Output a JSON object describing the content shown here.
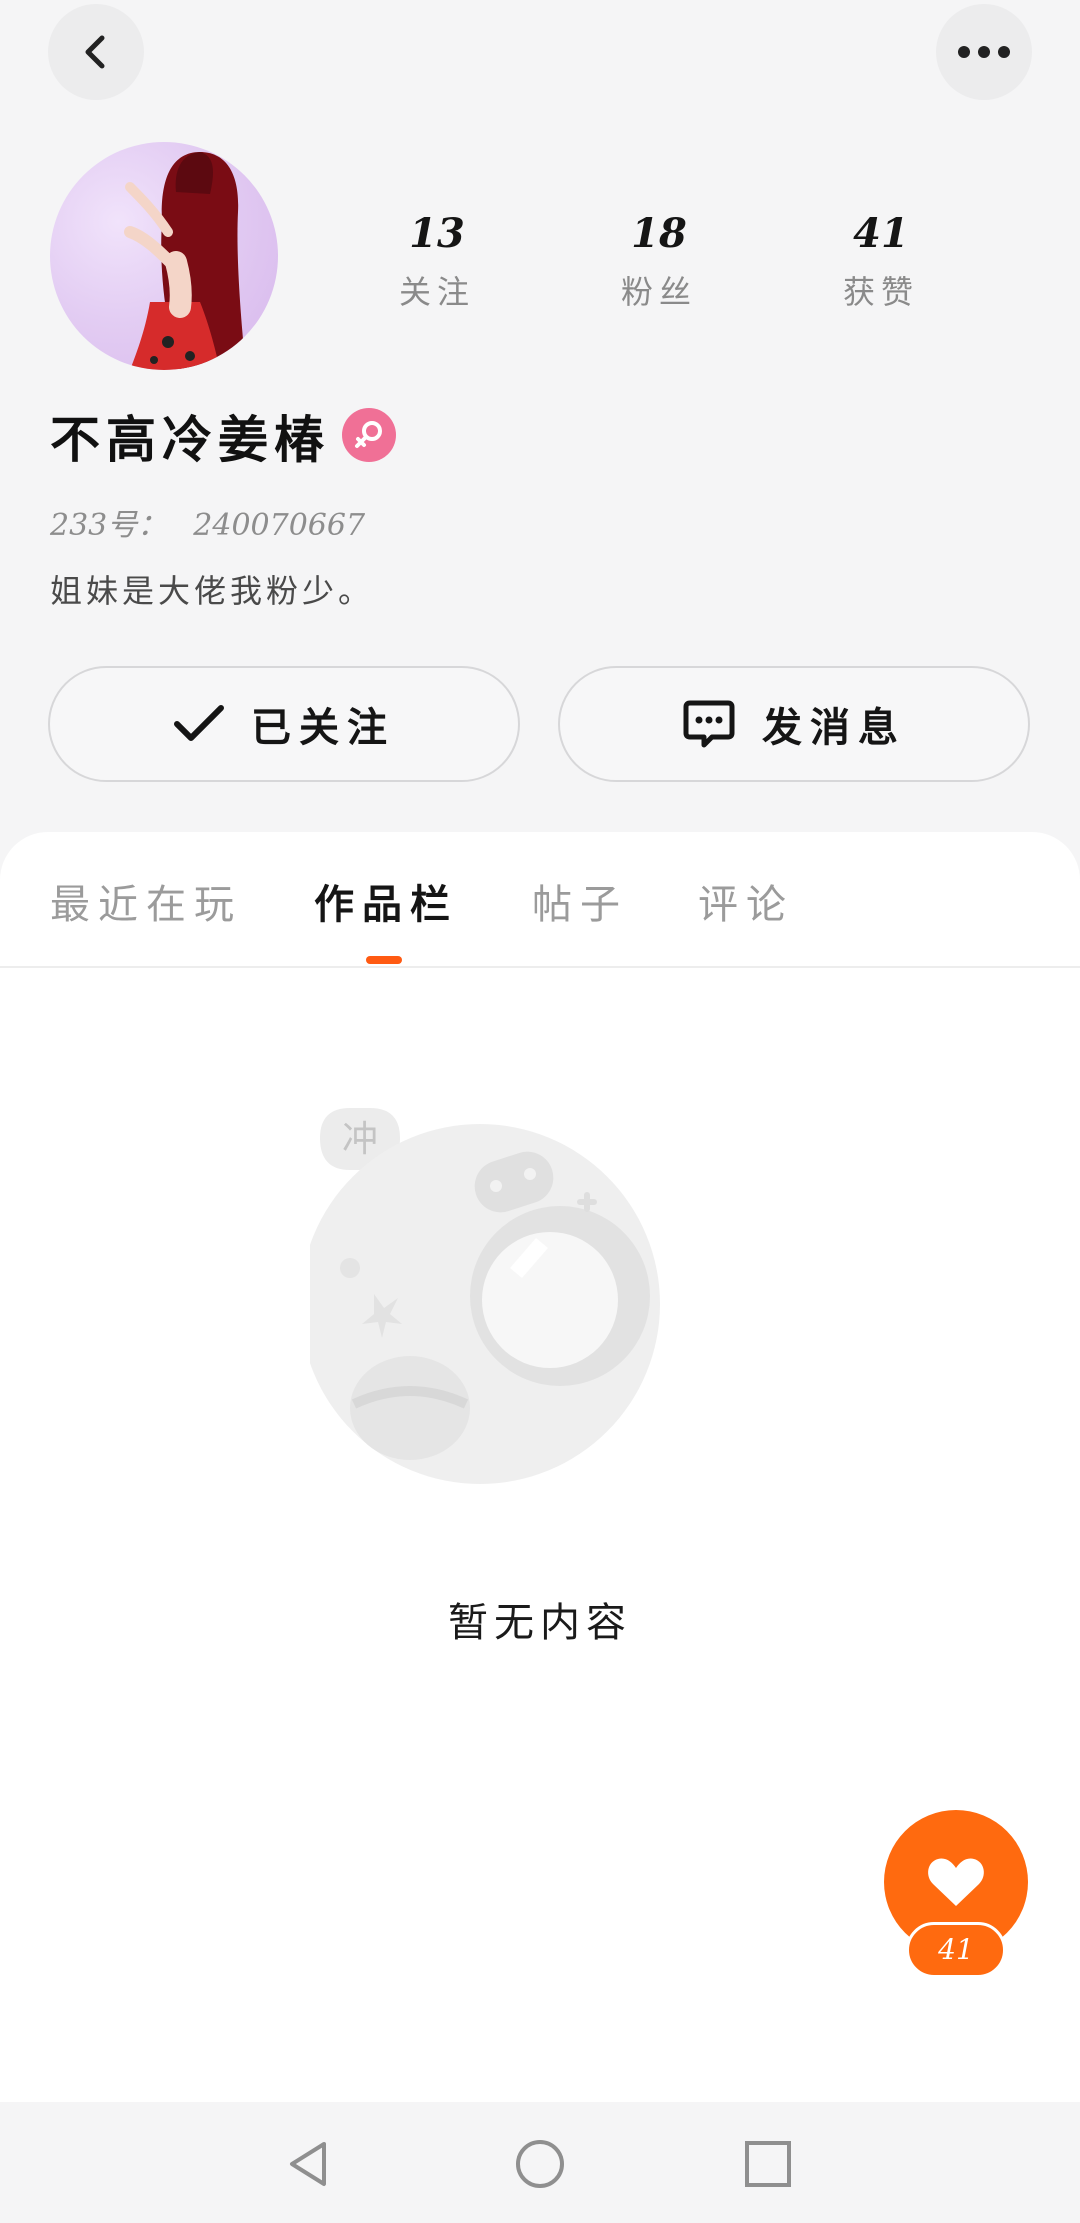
{
  "header": {
    "back_icon": "chevron-left-icon",
    "more_icon": "more-dots-icon"
  },
  "profile": {
    "name": "不高冷姜椿",
    "gender_icon": "female-icon",
    "id_label": "233号：",
    "id_value": "240070667",
    "bio": "姐妹是大佬我粉少。"
  },
  "stats": [
    {
      "value": "13",
      "label": "关注"
    },
    {
      "value": "18",
      "label": "粉丝"
    },
    {
      "value": "41",
      "label": "获赞"
    }
  ],
  "actions": {
    "follow_label": "已关注",
    "message_label": "发消息"
  },
  "tabs": [
    {
      "label": "最近在玩",
      "active": false
    },
    {
      "label": "作品栏",
      "active": true
    },
    {
      "label": "帖子",
      "active": false
    },
    {
      "label": "评论",
      "active": false
    }
  ],
  "empty": {
    "bubble_text": "冲",
    "text": "暂无内容"
  },
  "like": {
    "count": "41"
  },
  "colors": {
    "accent": "#ff6a0f",
    "gender_badge": "#f07096",
    "tab_indicator": "#ff5a12"
  }
}
